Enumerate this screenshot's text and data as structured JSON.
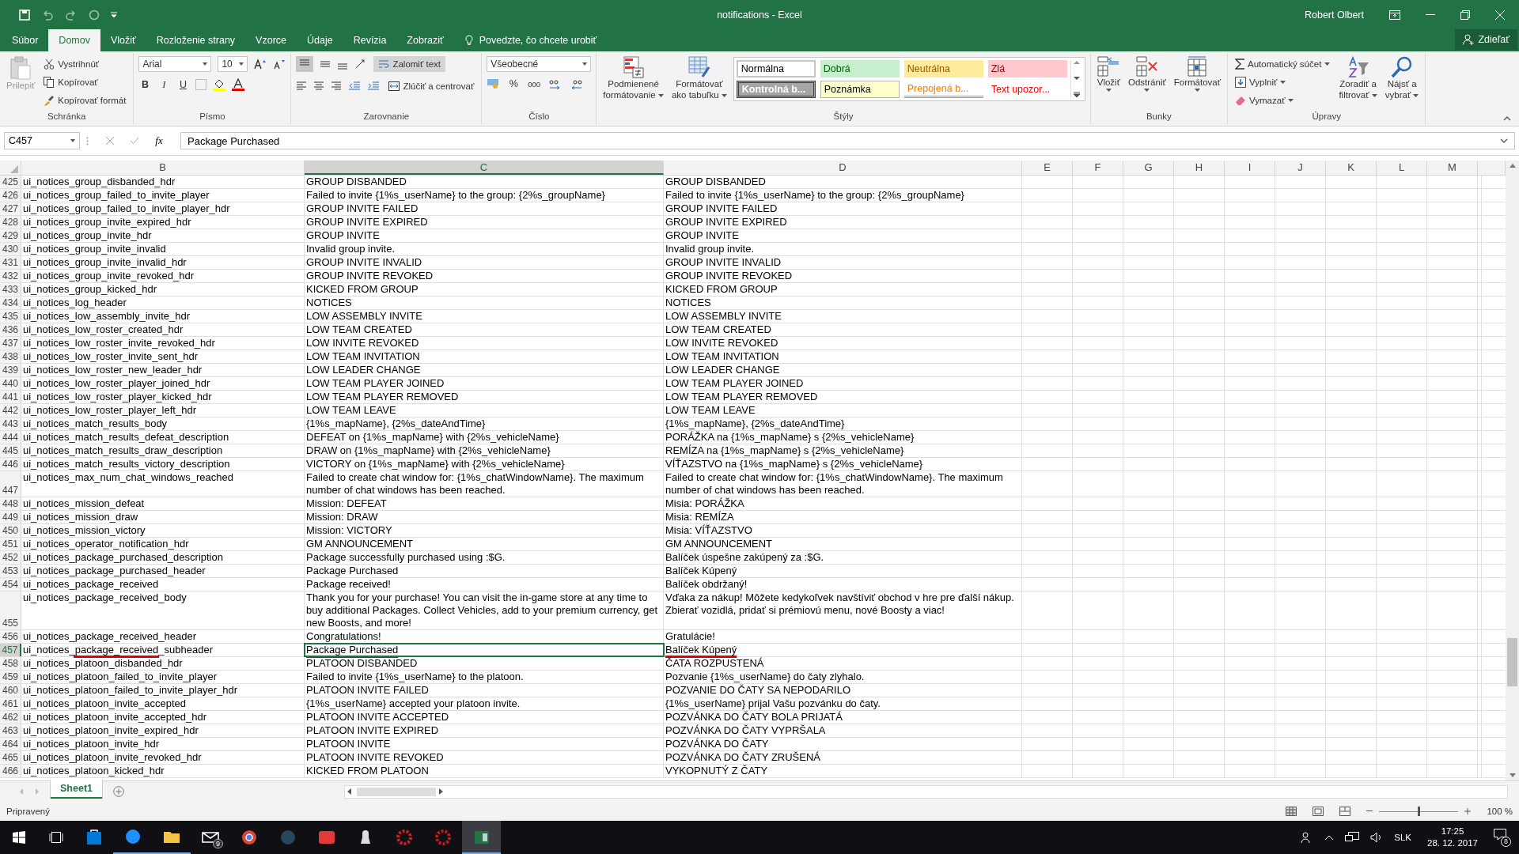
{
  "window": {
    "title": "notifications  -  Excel",
    "user": "Robert Olbert",
    "share": "Zdieľať"
  },
  "tabs": [
    {
      "label": "Súbor",
      "selected": false
    },
    {
      "label": "Domov",
      "selected": true
    },
    {
      "label": "Vložiť",
      "selected": false
    },
    {
      "label": "Rozloženie strany",
      "selected": false
    },
    {
      "label": "Vzorce",
      "selected": false
    },
    {
      "label": "Údaje",
      "selected": false
    },
    {
      "label": "Revízia",
      "selected": false
    },
    {
      "label": "Zobraziť",
      "selected": false
    }
  ],
  "tell_me": {
    "placeholder": "Povedzte, čo chcete urobiť"
  },
  "ribbon": {
    "clipboard": {
      "label": "Schránka",
      "paste": "Prilepiť",
      "cut": "Vystrihnúť",
      "copy": "Kopírovať",
      "painter": "Kopírovať formát"
    },
    "font": {
      "label": "Písmo",
      "family": "Arial",
      "size": "10",
      "bold": "B",
      "italic": "I",
      "underline": "U"
    },
    "alignment": {
      "label": "Zarovnanie",
      "wrap": "Zalomiť text",
      "merge": "Zlúčiť a centrovať"
    },
    "number": {
      "label": "Číslo",
      "format": "Všeobecné",
      "percent": "%",
      "thousands": "000"
    },
    "styles": {
      "label": "Štýly",
      "conditional": [
        "Podmienené",
        "formátovanie"
      ],
      "as_table": [
        "Formátovať",
        "ako tabuľku"
      ],
      "cells": [
        {
          "label": "Normálna",
          "kind": "normal"
        },
        {
          "label": "Dobrá",
          "kind": "good"
        },
        {
          "label": "Neutrálna",
          "kind": "neutral"
        },
        {
          "label": "Zlá",
          "kind": "bad"
        },
        {
          "label": "Kontrolná b...",
          "kind": "check"
        },
        {
          "label": "Poznámka",
          "kind": "note"
        },
        {
          "label": "Prepojená b...",
          "kind": "linked"
        },
        {
          "label": "Text upozor...",
          "kind": "warning"
        }
      ]
    },
    "cells": {
      "label": "Bunky",
      "insert": "Vložiť",
      "delete": "Odstrániť",
      "format": "Formátovať"
    },
    "editing": {
      "label": "Úpravy",
      "autosum": "Automatický súčet",
      "fill": "Vyplniť",
      "clear": "Vymazať",
      "sort": [
        "Zoradiť a",
        "filtrovať"
      ],
      "find": [
        "Nájsť a",
        "vybrať"
      ]
    }
  },
  "formula_bar": {
    "name_box": "C457",
    "fx": "fx",
    "value": "Package Purchased"
  },
  "columns": [
    {
      "label": "B",
      "selected": false
    },
    {
      "label": "C",
      "selected": true
    },
    {
      "label": "D",
      "selected": false
    },
    {
      "label": "E",
      "selected": false
    },
    {
      "label": "F",
      "selected": false
    },
    {
      "label": "G",
      "selected": false
    },
    {
      "label": "H",
      "selected": false
    },
    {
      "label": "I",
      "selected": false
    },
    {
      "label": "J",
      "selected": false
    },
    {
      "label": "K",
      "selected": false
    },
    {
      "label": "L",
      "selected": false
    },
    {
      "label": "M",
      "selected": false
    }
  ],
  "rows": [
    {
      "n": "425",
      "b": "ui_notices_group_disbanded_hdr",
      "c": "GROUP DISBANDED",
      "d": "GROUP DISBANDED",
      "selected": false,
      "marked": false
    },
    {
      "n": "426",
      "b": "ui_notices_group_failed_to_invite_player",
      "c": "Failed to invite {1%s_userName} to the group: {2%s_groupName}",
      "d": "Failed to invite {1%s_userName} to the group: {2%s_groupName}",
      "selected": false,
      "marked": false
    },
    {
      "n": "427",
      "b": "ui_notices_group_failed_to_invite_player_hdr",
      "c": "GROUP INVITE FAILED",
      "d": "GROUP INVITE FAILED",
      "selected": false,
      "marked": false
    },
    {
      "n": "428",
      "b": "ui_notices_group_invite_expired_hdr",
      "c": "GROUP INVITE EXPIRED",
      "d": "GROUP INVITE EXPIRED",
      "selected": false,
      "marked": false
    },
    {
      "n": "429",
      "b": "ui_notices_group_invite_hdr",
      "c": "GROUP INVITE",
      "d": "GROUP INVITE",
      "selected": false,
      "marked": false
    },
    {
      "n": "430",
      "b": "ui_notices_group_invite_invalid",
      "c": "Invalid group invite.",
      "d": "Invalid group invite.",
      "selected": false,
      "marked": false
    },
    {
      "n": "431",
      "b": "ui_notices_group_invite_invalid_hdr",
      "c": "GROUP INVITE INVALID",
      "d": "GROUP INVITE INVALID",
      "selected": false,
      "marked": false
    },
    {
      "n": "432",
      "b": "ui_notices_group_invite_revoked_hdr",
      "c": "GROUP INVITE REVOKED",
      "d": "GROUP INVITE REVOKED",
      "selected": false,
      "marked": false
    },
    {
      "n": "433",
      "b": "ui_notices_group_kicked_hdr",
      "c": "KICKED FROM GROUP",
      "d": "KICKED FROM GROUP",
      "selected": false,
      "marked": false
    },
    {
      "n": "434",
      "b": "ui_notices_log_header",
      "c": "NOTICES",
      "d": "NOTICES",
      "selected": false,
      "marked": false
    },
    {
      "n": "435",
      "b": "ui_notices_low_assembly_invite_hdr",
      "c": "LOW ASSEMBLY INVITE",
      "d": "LOW ASSEMBLY INVITE",
      "selected": false,
      "marked": false
    },
    {
      "n": "436",
      "b": "ui_notices_low_roster_created_hdr",
      "c": "LOW TEAM CREATED",
      "d": "LOW TEAM CREATED",
      "selected": false,
      "marked": false
    },
    {
      "n": "437",
      "b": "ui_notices_low_roster_invite_revoked_hdr",
      "c": "LOW INVITE REVOKED",
      "d": "LOW INVITE REVOKED",
      "selected": false,
      "marked": false
    },
    {
      "n": "438",
      "b": "ui_notices_low_roster_invite_sent_hdr",
      "c": "LOW TEAM INVITATION",
      "d": "LOW TEAM INVITATION",
      "selected": false,
      "marked": false
    },
    {
      "n": "439",
      "b": "ui_notices_low_roster_new_leader_hdr",
      "c": "LOW LEADER CHANGE",
      "d": "LOW LEADER CHANGE",
      "selected": false,
      "marked": false
    },
    {
      "n": "440",
      "b": "ui_notices_low_roster_player_joined_hdr",
      "c": "LOW TEAM PLAYER JOINED",
      "d": "LOW TEAM PLAYER JOINED",
      "selected": false,
      "marked": false
    },
    {
      "n": "441",
      "b": "ui_notices_low_roster_player_kicked_hdr",
      "c": "LOW TEAM PLAYER REMOVED",
      "d": "LOW TEAM PLAYER REMOVED",
      "selected": false,
      "marked": false
    },
    {
      "n": "442",
      "b": "ui_notices_low_roster_player_left_hdr",
      "c": "LOW TEAM LEAVE",
      "d": "LOW TEAM LEAVE",
      "selected": false,
      "marked": false
    },
    {
      "n": "443",
      "b": "ui_notices_match_results_body",
      "c": "{1%s_mapName}, {2%s_dateAndTime}",
      "d": "{1%s_mapName}, {2%s_dateAndTime}",
      "selected": false,
      "marked": false
    },
    {
      "n": "444",
      "b": "ui_notices_match_results_defeat_description",
      "c": "DEFEAT on {1%s_mapName} with {2%s_vehicleName}",
      "d": "PORÁŽKA na {1%s_mapName} s {2%s_vehicleName}",
      "selected": false,
      "marked": false
    },
    {
      "n": "445",
      "b": "ui_notices_match_results_draw_description",
      "c": "DRAW on {1%s_mapName} with {2%s_vehicleName}",
      "d": "REMÍZA na {1%s_mapName} s {2%s_vehicleName}",
      "selected": false,
      "marked": false
    },
    {
      "n": "446",
      "b": "ui_notices_match_results_victory_description",
      "c": "VICTORY on {1%s_mapName} with {2%s_vehicleName}",
      "d": "VÍŤAZSTVO na {1%s_mapName} s {2%s_vehicleName}",
      "selected": false,
      "marked": false
    },
    {
      "n": "447",
      "b": "ui_notices_max_num_chat_windows_reached",
      "c": "Failed to create chat window for: {1%s_chatWindowName}. The maximum number of chat windows has been reached.",
      "d": "Failed to create chat window for: {1%s_chatWindowName}. The maximum number of chat windows has been reached.",
      "selected": false,
      "marked": false
    },
    {
      "n": "448",
      "b": "ui_notices_mission_defeat",
      "c": "Mission: DEFEAT",
      "d": "Misia: PORÁŽKA",
      "selected": false,
      "marked": false
    },
    {
      "n": "449",
      "b": "ui_notices_mission_draw",
      "c": "Mission: DRAW",
      "d": "Misia: REMÍZA",
      "selected": false,
      "marked": false
    },
    {
      "n": "450",
      "b": "ui_notices_mission_victory",
      "c": "Mission: VICTORY",
      "d": "Misia: VÍŤAZSTVO",
      "selected": false,
      "marked": false
    },
    {
      "n": "451",
      "b": "ui_notices_operator_notification_hdr",
      "c": "GM ANNOUNCEMENT",
      "d": "GM ANNOUNCEMENT",
      "selected": false,
      "marked": false
    },
    {
      "n": "452",
      "b": "ui_notices_package_purchased_description",
      "c": "Package successfully purchased using :$G.",
      "d": "Balíček úspešne zakúpený za :$G.",
      "selected": false,
      "marked": false
    },
    {
      "n": "453",
      "b": "ui_notices_package_purchased_header",
      "c": "Package Purchased",
      "d": "Balíček Kúpený",
      "selected": false,
      "marked": false
    },
    {
      "n": "454",
      "b": "ui_notices_package_received",
      "c": "Package received!",
      "d": "Balíček obdržaný!",
      "selected": false,
      "marked": false
    },
    {
      "n": "455",
      "b": "ui_notices_package_received_body",
      "c": "Thank you for your purchase! You can visit the in-game store at any time to buy additional Packages. Collect Vehicles, add to your premium currency, get new Boosts, and more!",
      "d": "Vďaka za nákup! Môžete kedykoľvek navštíviť obchod v hre pre ďalší nákup. Zbierať vozidlá, pridať si prémiovú menu, nové Boosty a viac!",
      "selected": false,
      "marked": false
    },
    {
      "n": "456",
      "b": "ui_notices_package_received_header",
      "c": "Congratulations!",
      "d": "Gratulácie!",
      "selected": false,
      "marked": false
    },
    {
      "n": "457",
      "b": "ui_notices_package_received_subheader",
      "c": "Package Purchased",
      "d": "Balíček Kúpený",
      "selected": true,
      "marked": true
    },
    {
      "n": "458",
      "b": "ui_notices_platoon_disbanded_hdr",
      "c": "PLATOON DISBANDED",
      "d": "ČATA ROZPUSTENÁ",
      "selected": false,
      "marked": false
    },
    {
      "n": "459",
      "b": "ui_notices_platoon_failed_to_invite_player",
      "c": "Failed to invite {1%s_userName} to the platoon.",
      "d": "Pozvanie {1%s_userName} do čaty zlyhalo.",
      "selected": false,
      "marked": false
    },
    {
      "n": "460",
      "b": "ui_notices_platoon_failed_to_invite_player_hdr",
      "c": "PLATOON INVITE FAILED",
      "d": "POZVANIE DO ČATY SA NEPODARILO",
      "selected": false,
      "marked": false
    },
    {
      "n": "461",
      "b": "ui_notices_platoon_invite_accepted",
      "c": "{1%s_userName} accepted your platoon invite.",
      "d": "{1%s_userName} prijal Vašu pozvánku do čaty.",
      "selected": false,
      "marked": false
    },
    {
      "n": "462",
      "b": "ui_notices_platoon_invite_accepted_hdr",
      "c": "PLATOON INVITE ACCEPTED",
      "d": "POZVÁNKA DO ČATY BOLA PRIJATÁ",
      "selected": false,
      "marked": false
    },
    {
      "n": "463",
      "b": "ui_notices_platoon_invite_expired_hdr",
      "c": "PLATOON INVITE EXPIRED",
      "d": "POZVÁNKA DO ČATY VYPRŠALA",
      "selected": false,
      "marked": false
    },
    {
      "n": "464",
      "b": "ui_notices_platoon_invite_hdr",
      "c": "PLATOON INVITE",
      "d": "POZVÁNKA DO ČATY",
      "selected": false,
      "marked": false
    },
    {
      "n": "465",
      "b": "ui_notices_platoon_invite_revoked_hdr",
      "c": "PLATOON INVITE REVOKED",
      "d": "POZVÁNKA DO ČATY ZRUŠENÁ",
      "selected": false,
      "marked": false
    },
    {
      "n": "466",
      "b": "ui_notices_platoon_kicked_hdr",
      "c": "KICKED FROM PLATOON",
      "d": "VYKOPNUTÝ Z ČATY",
      "selected": false,
      "marked": false
    }
  ],
  "sheets": [
    {
      "label": "Sheet1",
      "selected": true
    }
  ],
  "status_bar": {
    "text": "Pripravený",
    "zoom": "100 %",
    "zoom_slider": {
      "level": 0.5
    }
  },
  "taskbar": {
    "apps": [
      {
        "kind": "store",
        "selected": false,
        "running": false
      },
      {
        "kind": "edge",
        "selected": false,
        "running": true
      },
      {
        "kind": "explorer",
        "selected": false,
        "running": true
      },
      {
        "kind": "mail",
        "selected": false,
        "running": false,
        "badge": "9"
      },
      {
        "kind": "chrome",
        "selected": false,
        "running": false
      },
      {
        "kind": "steam",
        "selected": false,
        "running": false
      },
      {
        "kind": "gamepad",
        "selected": false,
        "running": false
      },
      {
        "kind": "figure",
        "selected": false,
        "running": false
      },
      {
        "kind": "redgear",
        "selected": false,
        "running": false
      },
      {
        "kind": "gear",
        "selected": false,
        "running": false
      },
      {
        "kind": "excel",
        "selected": true,
        "running": true
      }
    ],
    "language": "SLK",
    "time": "17:25",
    "date": "28. 12. 2017",
    "notifications": "8"
  }
}
